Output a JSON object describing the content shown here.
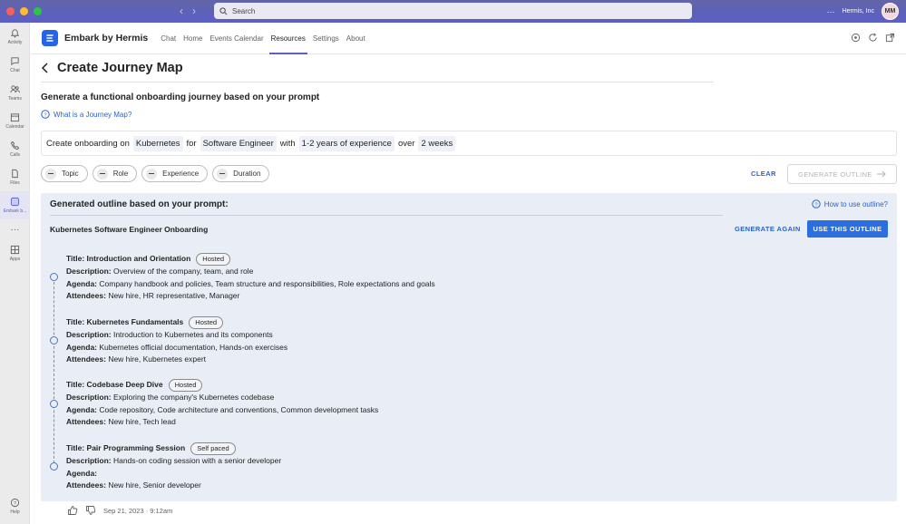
{
  "titlebar": {
    "search_placeholder": "Search",
    "org_name": "Hermis, Inc",
    "avatar_initials": "MM",
    "more_label": "···"
  },
  "rail": {
    "items": [
      {
        "label": "Activity",
        "icon": "bell-icon"
      },
      {
        "label": "Chat",
        "icon": "chat-icon"
      },
      {
        "label": "Teams",
        "icon": "teams-icon"
      },
      {
        "label": "Calendar",
        "icon": "calendar-icon"
      },
      {
        "label": "Calls",
        "icon": "phone-icon"
      },
      {
        "label": "Files",
        "icon": "file-icon"
      },
      {
        "label": "Embark b...",
        "icon": "embark-icon"
      },
      {
        "label": "···",
        "icon": "more-icon"
      },
      {
        "label": "Apps",
        "icon": "apps-icon"
      }
    ],
    "help_label": "Help"
  },
  "app": {
    "name": "Embark by Hermis",
    "tabs": [
      "Chat",
      "Home",
      "Events Calendar",
      "Resources",
      "Settings",
      "About"
    ],
    "active_tab": "Resources"
  },
  "page": {
    "title": "Create Journey Map",
    "heading": "Generate a functional onboarding journey based on your prompt",
    "what_is_link": "What is a Journey Map?"
  },
  "prompt": {
    "part1": "Create onboarding on",
    "topic": "Kubernetes",
    "part2": "for",
    "role": "Software Engineer",
    "part3": "with",
    "experience": "1-2 years of experience",
    "part4": "over",
    "duration": "2 weeks"
  },
  "pills": [
    "Topic",
    "Role",
    "Experience",
    "Duration"
  ],
  "actions": {
    "clear": "CLEAR",
    "generate_outline": "GENERATE OUTLINE"
  },
  "outline": {
    "header": "Generated outline based on your prompt:",
    "how_to": "How to use outline?",
    "name": "Kubernetes Software Engineer Onboarding",
    "generate_again": "GENERATE AGAIN",
    "use_this": "USE THIS OUTLINE",
    "labels": {
      "title": "Title:",
      "description": "Description:",
      "agenda": "Agenda:",
      "attendees": "Attendees:"
    },
    "sessions": [
      {
        "title": "Introduction and Orientation",
        "tag": "Hosted",
        "description": "Overview of the company, team, and role",
        "agenda": "Company handbook and policies, Team structure and responsibilities, Role expectations and goals",
        "attendees": "New hire, HR representative, Manager"
      },
      {
        "title": "Kubernetes Fundamentals",
        "tag": "Hosted",
        "description": "Introduction to Kubernetes and its components",
        "agenda": "Kubernetes official documentation, Hands-on exercises",
        "attendees": "New hire, Kubernetes expert"
      },
      {
        "title": "Codebase Deep Dive",
        "tag": "Hosted",
        "description": "Exploring the company's Kubernetes codebase",
        "agenda": "Code repository, Code architecture and conventions, Common development tasks",
        "attendees": "New hire, Tech lead"
      },
      {
        "title": "Pair Programming Session",
        "tag": "Self paced",
        "description": "Hands-on coding session with a senior developer",
        "agenda": "",
        "attendees": "New hire, Senior developer"
      }
    ]
  },
  "footer": {
    "timestamp": "Sep 21, 2023 · 9:12am"
  },
  "colors": {
    "titlebar": "#5b5fc7",
    "accent_blue": "#2b6ee0",
    "panel_bg": "#e8edf6"
  }
}
